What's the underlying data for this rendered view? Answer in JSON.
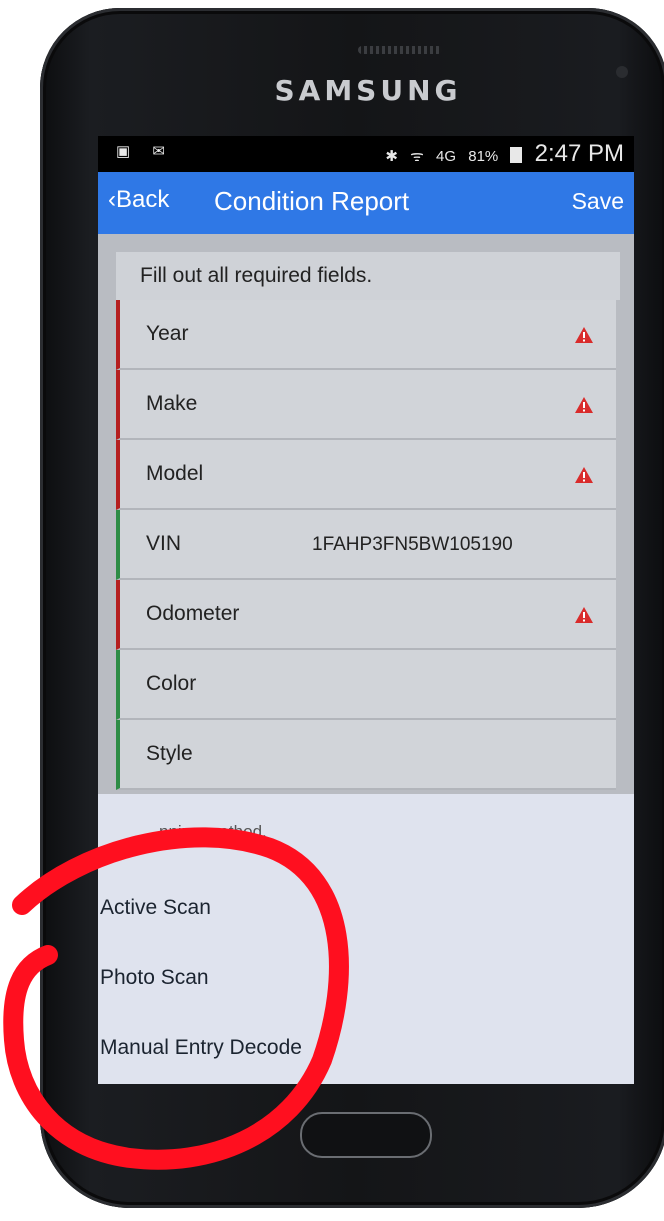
{
  "device": {
    "brand": "SAMSUNG"
  },
  "status_bar": {
    "left_icons": [
      "nfl-icon",
      "mail-icon"
    ],
    "bluetooth": "✱",
    "wifi": "ᯤ",
    "network": "4G",
    "battery": "81%",
    "time": "2:47 PM"
  },
  "nav": {
    "back_label": "Back",
    "title": "Condition Report",
    "save_label": "Save"
  },
  "notice": "Fill out all required fields.",
  "fields": [
    {
      "label": "Year",
      "value": "",
      "status": "required"
    },
    {
      "label": "Make",
      "value": "",
      "status": "required"
    },
    {
      "label": "Model",
      "value": "",
      "status": "required"
    },
    {
      "label": "VIN",
      "value": "1FAHP3FN5BW105190",
      "status": "ok"
    },
    {
      "label": "Odometer",
      "value": "",
      "status": "required"
    },
    {
      "label": "Color",
      "value": "",
      "status": "ok"
    },
    {
      "label": "Style",
      "value": "",
      "status": "ok"
    }
  ],
  "sheet": {
    "title": "…nning method.",
    "options": [
      "Active Scan",
      "Photo Scan",
      "Manual Entry Decode"
    ]
  },
  "colors": {
    "nav_blue": "#2f78e6",
    "required_red": "#b51f1f",
    "ok_green": "#2d8c45",
    "annotation_red": "#ff0f1f"
  }
}
